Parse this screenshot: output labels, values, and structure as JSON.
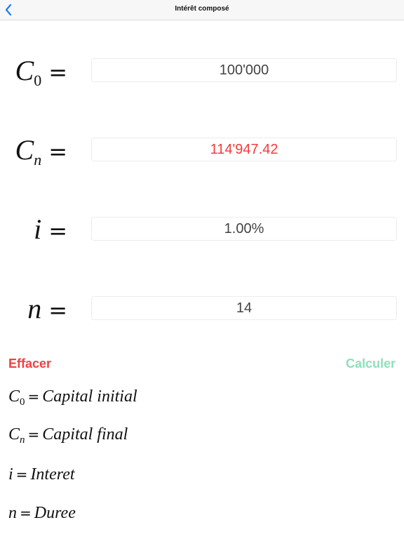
{
  "navbar": {
    "title": "Intérêt composé",
    "back_icon": "chevron-left-icon",
    "accent_color": "#1a7cf5"
  },
  "fields": [
    {
      "symbol": "C",
      "subscript": "0",
      "equals": "=",
      "value": "100'000",
      "color": "#444444"
    },
    {
      "symbol": "C",
      "subscript": "n",
      "equals": "=",
      "value": "114'947.42",
      "color": "#f03c3c"
    },
    {
      "symbol": "i",
      "subscript": "",
      "equals": "=",
      "value": "1.00%",
      "color": "#444444"
    },
    {
      "symbol": "n",
      "subscript": "",
      "equals": "=",
      "value": "14",
      "color": "#444444"
    }
  ],
  "actions": {
    "clear_label": "Effacer",
    "calculate_label": "Calculer",
    "clear_color": "#ef4141",
    "calculate_color": "#8fe0bd"
  },
  "legend": [
    {
      "symbol": "C",
      "subscript": "0",
      "equals": "=",
      "text": "Capital initial"
    },
    {
      "symbol": "C",
      "subscript": "n",
      "equals": "=",
      "text": "Capital final"
    },
    {
      "symbol": "i",
      "subscript": "",
      "equals": "=",
      "text": "Interet"
    },
    {
      "symbol": "n",
      "subscript": "",
      "equals": "=",
      "text": "Duree"
    }
  ]
}
